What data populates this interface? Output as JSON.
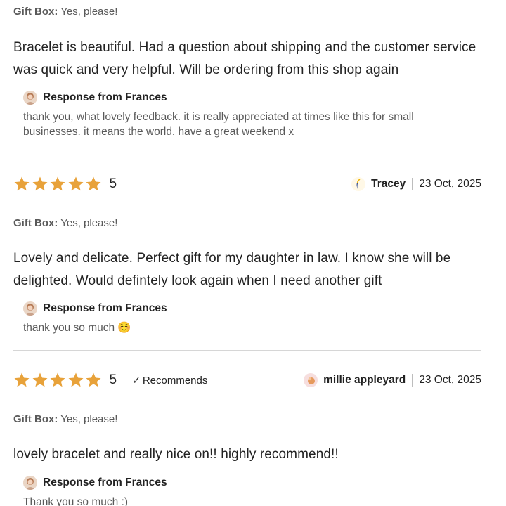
{
  "gift_label": "Gift Box:",
  "response_label": "Response from Frances",
  "colors": {
    "star": "#E8A23A",
    "divider": "#d6d6d6",
    "muted": "#595959"
  },
  "reviews": [
    {
      "gift_value": "Yes, please!",
      "text": "Bracelet is beautiful. Had a question about shipping and the customer service was quick and very helpful. Will be ordering from this shop again",
      "response": "thank you, what lovely feedback. it is really appreciated at times like this for small businesses. it means the world. have a great weekend x"
    },
    {
      "rating": "5",
      "stars": 5,
      "reviewer": "Tracey",
      "date": "23 Oct, 2025",
      "gift_value": "Yes, please!",
      "text": "Lovely and delicate. Perfect gift for my daughter in law. I know she will be delighted. Would defintely look again when I need another gift",
      "response": "thank you so much ☺️"
    },
    {
      "rating": "5",
      "stars": 5,
      "recommends": "Recommends",
      "reviewer": "millie appleyard",
      "date": "23 Oct, 2025",
      "gift_value": "Yes, please!",
      "text": "lovely bracelet and really nice on!! highly recommend!!",
      "response": "Thank you so much :)"
    }
  ]
}
